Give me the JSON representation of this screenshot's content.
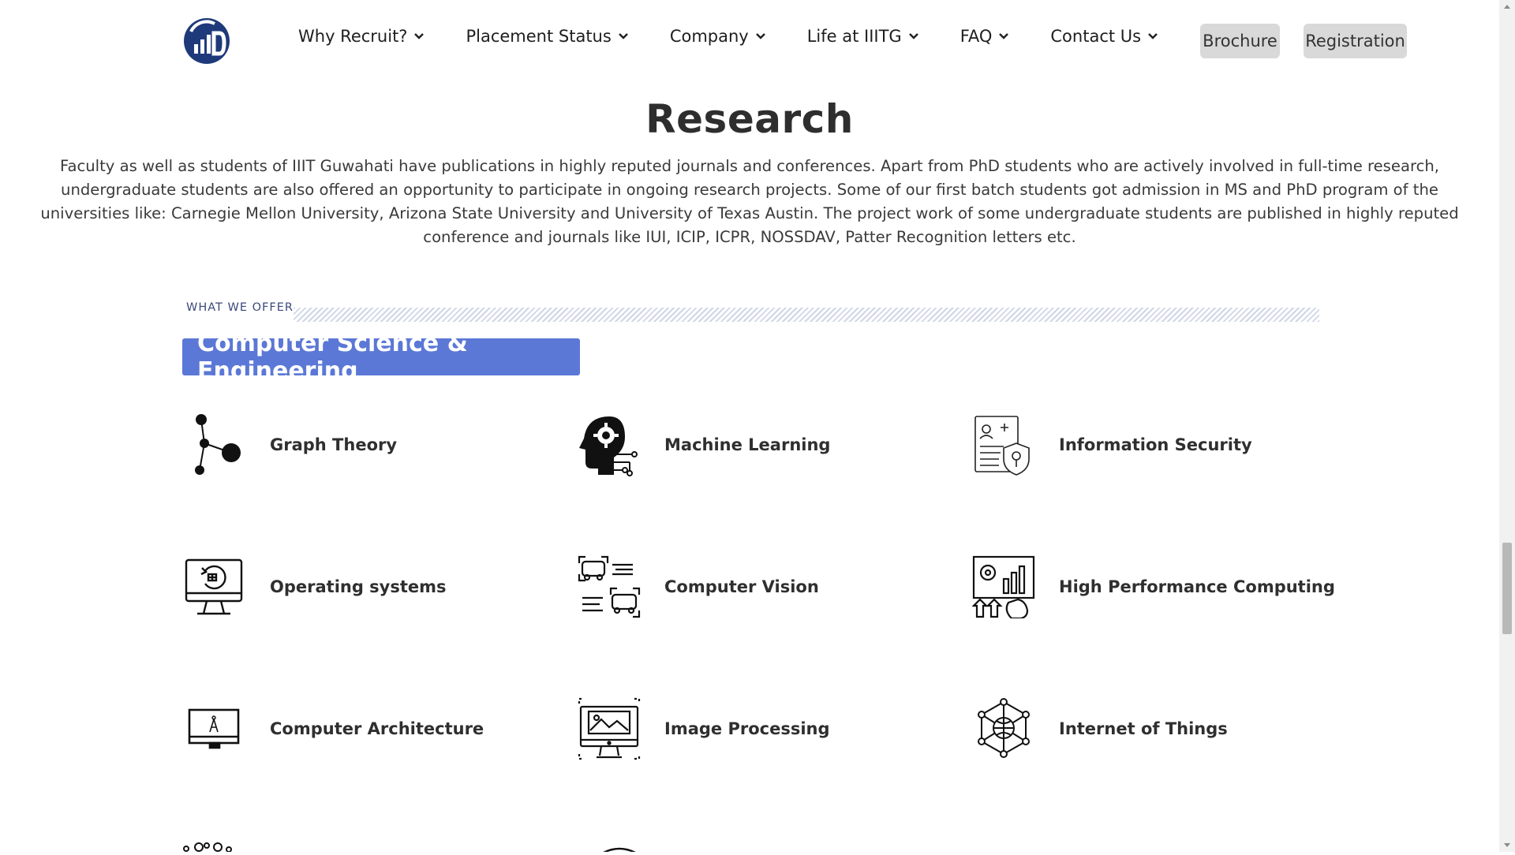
{
  "nav": {
    "items": [
      {
        "label": "Why Recruit?"
      },
      {
        "label": "Placement Status"
      },
      {
        "label": "Company"
      },
      {
        "label": "Life at IIITG"
      },
      {
        "label": "FAQ"
      },
      {
        "label": "Contact Us"
      }
    ],
    "brochure_label": "Brochure",
    "registration_label": "Registration"
  },
  "research": {
    "title": "Research",
    "text": "Faculty as well as students of IIIT Guwahati have publications in highly reputed journals and conferences. Apart from PhD students who are actively involved in full-time research, undergraduate students are also offered an opportunity to participate in ongoing research projects. Some of our first batch students got admission in MS and PhD program of the universities like: Carnegie Mellon University, Arizona State University and University of Texas Austin. The project work of some undergraduate students are published in highly reputed conference and journals like IUI, ICIP, ICPR, NOSSDAV, Patter Recognition letters etc."
  },
  "offer": {
    "label": "WHAT WE OFFER",
    "department": "Computer Science & Engineering",
    "topics": [
      {
        "label": "Graph Theory",
        "icon": "graph-icon"
      },
      {
        "label": "Machine Learning",
        "icon": "brain-gear-icon"
      },
      {
        "label": "Information Security",
        "icon": "shield-document-icon"
      },
      {
        "label": "Operating systems",
        "icon": "monitor-refresh-icon"
      },
      {
        "label": "Computer Vision",
        "icon": "cars-detection-icon"
      },
      {
        "label": "High Performance Computing",
        "icon": "gear-chart-icon"
      },
      {
        "label": "Computer Architecture",
        "icon": "monitor-compass-icon"
      },
      {
        "label": "Image Processing",
        "icon": "monitor-image-icon"
      },
      {
        "label": "Internet of Things",
        "icon": "network-globe-icon"
      }
    ]
  },
  "colors": {
    "accent": "#5b78d6",
    "logo": "#1f3a7a",
    "button_bg": "#d9d9d9"
  }
}
